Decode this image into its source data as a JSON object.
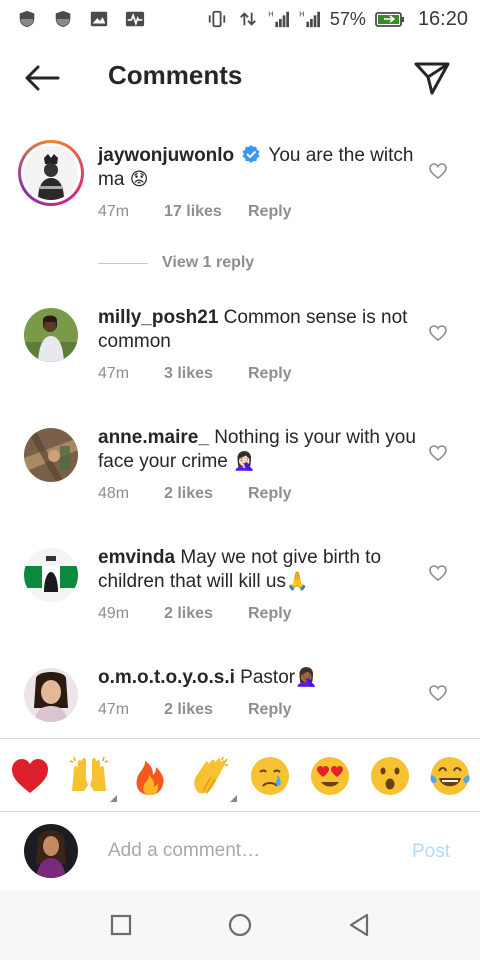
{
  "status_bar": {
    "battery_percent": "57%",
    "time": "16:20",
    "icons": [
      "shield-icon",
      "shield-icon",
      "image-icon",
      "activity-icon",
      "vibrate-icon",
      "data-transfer-icon",
      "signal-h-icon",
      "signal-h-icon",
      "battery-icon"
    ]
  },
  "header": {
    "title": "Comments",
    "back_icon": "arrow-left-icon",
    "send_icon": "paper-plane-icon"
  },
  "comments": [
    {
      "username": "jaywonjuwonlo",
      "verified": true,
      "text": "You are the witch ma",
      "emoji": "😟",
      "time": "47m",
      "likes": "17 likes",
      "reply": "Reply"
    },
    {
      "username": "milly_posh21",
      "text": "Common sense is not common",
      "emoji": "",
      "time": "47m",
      "likes": "3 likes",
      "reply": "Reply"
    },
    {
      "username": "anne.maire_",
      "text": "Nothing is your with you face your crime",
      "emoji": "🤦🏻‍♀️",
      "time": "48m",
      "likes": "2 likes",
      "reply": "Reply"
    },
    {
      "username": "emvinda",
      "text": "May we not give birth to children that will kill us",
      "emoji": "🙏",
      "time": "49m",
      "likes": "2 likes",
      "reply": "Reply"
    },
    {
      "username": "o.m.o.t.o.y.o.s.i",
      "text": "Pastor",
      "emoji": "🤦🏾‍♀️",
      "time": "47m",
      "likes": "2 likes",
      "reply": "Reply"
    }
  ],
  "view_replies": "View 1 reply",
  "emoji_bar": [
    "red-heart",
    "raising-hands",
    "fire",
    "clapping-hands",
    "crying-face",
    "heart-eyes",
    "astonished-face",
    "tears-of-joy"
  ],
  "composer": {
    "placeholder": "Add a comment…",
    "post_label": "Post"
  },
  "colors": {
    "text": "#262626",
    "meta": "#8e8e8e",
    "post_disabled": "#b3dbff",
    "verified": "#3897f0",
    "heart": "#e0202a"
  },
  "nav_bar": [
    "square-icon",
    "circle-icon",
    "triangle-back-icon"
  ]
}
